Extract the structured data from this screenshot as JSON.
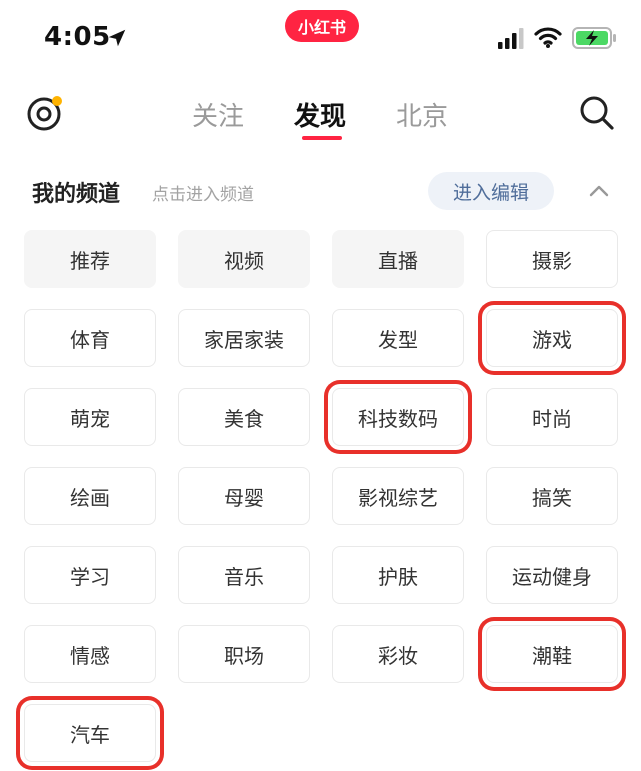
{
  "status_bar": {
    "time": "4:05",
    "app_badge": "小红书",
    "icons": [
      "location-arrow-icon",
      "cellular-signal-icon",
      "wifi-icon",
      "battery-charging-icon"
    ],
    "battery_color": "#4cd964"
  },
  "top_nav": {
    "left_icon": "camera-dot-icon",
    "tabs": [
      {
        "label": "关注",
        "active": false
      },
      {
        "label": "发现",
        "active": true
      },
      {
        "label": "北京",
        "active": false
      }
    ],
    "right_icon": "search-icon",
    "accent_color": "#ff2442"
  },
  "section": {
    "title": "我的频道",
    "hint": "点击进入频道",
    "edit_label": "进入编辑",
    "collapse_icon": "chevron-up-icon"
  },
  "channels": [
    {
      "label": "推荐",
      "fixed": true,
      "marked": false
    },
    {
      "label": "视频",
      "fixed": true,
      "marked": false
    },
    {
      "label": "直播",
      "fixed": true,
      "marked": false
    },
    {
      "label": "摄影",
      "fixed": false,
      "marked": false
    },
    {
      "label": "体育",
      "fixed": false,
      "marked": false
    },
    {
      "label": "家居家装",
      "fixed": false,
      "marked": false
    },
    {
      "label": "发型",
      "fixed": false,
      "marked": false
    },
    {
      "label": "游戏",
      "fixed": false,
      "marked": true
    },
    {
      "label": "萌宠",
      "fixed": false,
      "marked": false
    },
    {
      "label": "美食",
      "fixed": false,
      "marked": false
    },
    {
      "label": "科技数码",
      "fixed": false,
      "marked": true
    },
    {
      "label": "时尚",
      "fixed": false,
      "marked": false
    },
    {
      "label": "绘画",
      "fixed": false,
      "marked": false
    },
    {
      "label": "母婴",
      "fixed": false,
      "marked": false
    },
    {
      "label": "影视综艺",
      "fixed": false,
      "marked": false
    },
    {
      "label": "搞笑",
      "fixed": false,
      "marked": false
    },
    {
      "label": "学习",
      "fixed": false,
      "marked": false
    },
    {
      "label": "音乐",
      "fixed": false,
      "marked": false
    },
    {
      "label": "护肤",
      "fixed": false,
      "marked": false
    },
    {
      "label": "运动健身",
      "fixed": false,
      "marked": false
    },
    {
      "label": "情感",
      "fixed": false,
      "marked": false
    },
    {
      "label": "职场",
      "fixed": false,
      "marked": false
    },
    {
      "label": "彩妆",
      "fixed": false,
      "marked": false
    },
    {
      "label": "潮鞋",
      "fixed": false,
      "marked": true
    },
    {
      "label": "汽车",
      "fixed": false,
      "marked": true
    }
  ],
  "highlight_color": "#e8302a"
}
